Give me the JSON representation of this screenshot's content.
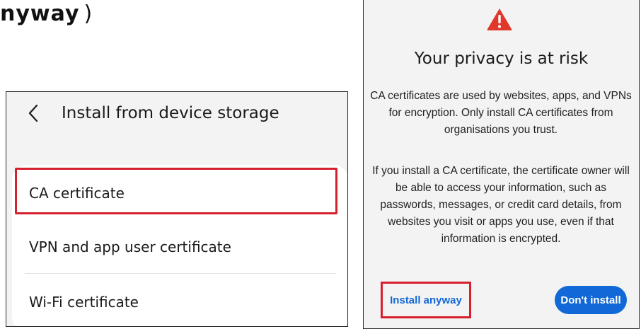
{
  "heading": {
    "text": "nyway",
    "suffix": ")"
  },
  "left_screen": {
    "title": "Install from device storage",
    "items": [
      {
        "label": "CA certificate",
        "highlighted": true
      },
      {
        "label": "VPN and app user certificate",
        "highlighted": false
      },
      {
        "label": "Wi-Fi certificate",
        "highlighted": false
      }
    ]
  },
  "dialog": {
    "icon": "warning-triangle-icon",
    "title": "Your privacy is at risk",
    "body_1": "CA certificates are used by websites, apps, and VPNs for encryption. Only install CA certificates from organisations you trust.",
    "body_2": "If you install a CA certificate, the certificate owner will be able to access your information, such as passwords, messages, or credit card details, from websites you visit or apps you use, even if that information is encrypted.",
    "install_label": "Install anyway",
    "dont_install_label": "Don't install"
  },
  "colors": {
    "highlight": "#d6202f",
    "accent": "#1268d6",
    "warning": "#e0382b",
    "panel_bg": "#f3f3f3"
  }
}
